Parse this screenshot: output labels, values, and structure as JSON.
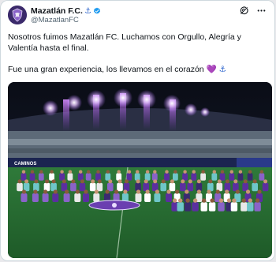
{
  "tweet": {
    "display_name": "Mazatlán F.C.",
    "name_emoji": "⚓",
    "handle": "@MazatlanFC",
    "verified": true,
    "text_line1": "Nosotros fuimos Mazatlán FC. Luchamos con Orgullo, Alegría y Valentía hasta el final.",
    "text_line2": "Fue una gran experiencia, los llevamos en el corazón",
    "text_line2_emojis": [
      "💜",
      "⚓"
    ],
    "photo": {
      "subject": "team-group-photo-on-pitch",
      "stadium_sponsor_text": "CAMINOS"
    }
  },
  "icons": {
    "avatar": "club-crest-icon",
    "verified": "verified-badge-icon",
    "grok": "grok-icon",
    "more": "more-options-icon"
  },
  "colors": {
    "text": "#0f1419",
    "secondary_text": "#536471",
    "verified_blue": "#1d9bf0",
    "heart": "#b28ed8",
    "team_purple": "#5b2fa0"
  }
}
